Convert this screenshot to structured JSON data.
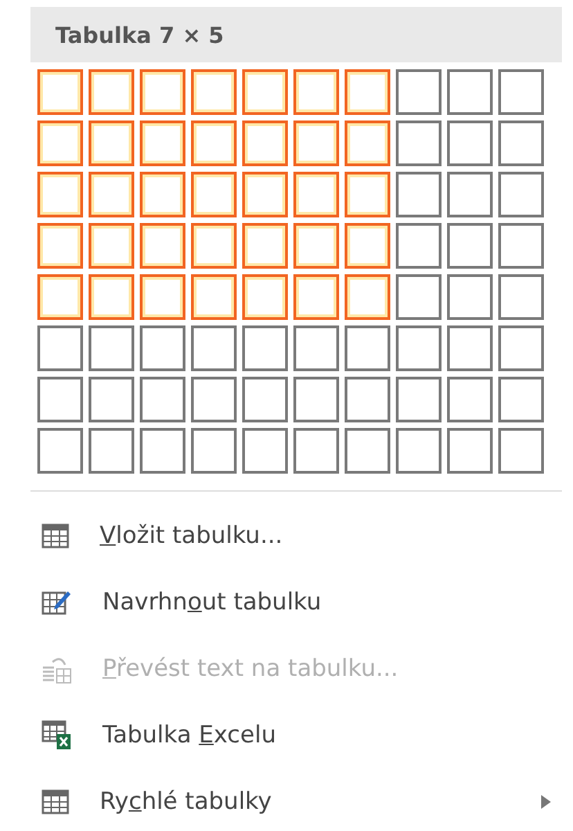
{
  "header": {
    "title": "Tabulka 7 × 5"
  },
  "grid": {
    "rows": [
      [
        {
          "selected": true
        },
        {
          "selected": true
        },
        {
          "selected": true
        },
        {
          "selected": true
        },
        {
          "selected": true
        },
        {
          "selected": true
        },
        {
          "selected": true
        },
        {
          "selected": false
        },
        {
          "selected": false
        },
        {
          "selected": false
        }
      ],
      [
        {
          "selected": true
        },
        {
          "selected": true
        },
        {
          "selected": true
        },
        {
          "selected": true
        },
        {
          "selected": true
        },
        {
          "selected": true
        },
        {
          "selected": true
        },
        {
          "selected": false
        },
        {
          "selected": false
        },
        {
          "selected": false
        }
      ],
      [
        {
          "selected": true
        },
        {
          "selected": true
        },
        {
          "selected": true
        },
        {
          "selected": true
        },
        {
          "selected": true
        },
        {
          "selected": true
        },
        {
          "selected": true
        },
        {
          "selected": false
        },
        {
          "selected": false
        },
        {
          "selected": false
        }
      ],
      [
        {
          "selected": true
        },
        {
          "selected": true
        },
        {
          "selected": true
        },
        {
          "selected": true
        },
        {
          "selected": true
        },
        {
          "selected": true
        },
        {
          "selected": true
        },
        {
          "selected": false
        },
        {
          "selected": false
        },
        {
          "selected": false
        }
      ],
      [
        {
          "selected": true
        },
        {
          "selected": true
        },
        {
          "selected": true
        },
        {
          "selected": true
        },
        {
          "selected": true
        },
        {
          "selected": true
        },
        {
          "selected": true
        },
        {
          "selected": false
        },
        {
          "selected": false
        },
        {
          "selected": false
        }
      ],
      [
        {
          "selected": false
        },
        {
          "selected": false
        },
        {
          "selected": false
        },
        {
          "selected": false
        },
        {
          "selected": false
        },
        {
          "selected": false
        },
        {
          "selected": false
        },
        {
          "selected": false
        },
        {
          "selected": false
        },
        {
          "selected": false
        }
      ],
      [
        {
          "selected": false
        },
        {
          "selected": false
        },
        {
          "selected": false
        },
        {
          "selected": false
        },
        {
          "selected": false
        },
        {
          "selected": false
        },
        {
          "selected": false
        },
        {
          "selected": false
        },
        {
          "selected": false
        },
        {
          "selected": false
        }
      ],
      [
        {
          "selected": false
        },
        {
          "selected": false
        },
        {
          "selected": false
        },
        {
          "selected": false
        },
        {
          "selected": false
        },
        {
          "selected": false
        },
        {
          "selected": false
        },
        {
          "selected": false
        },
        {
          "selected": false
        },
        {
          "selected": false
        }
      ]
    ]
  },
  "menu": [
    {
      "kind": "insert",
      "access_key": "V",
      "label_after": "ložit tabulku...",
      "disabled": false,
      "submenu": false
    },
    {
      "kind": "draw",
      "label_before": "Navrhn",
      "access_key": "o",
      "label_after": "ut tabulku",
      "disabled": false,
      "submenu": false
    },
    {
      "kind": "convert",
      "access_key": "P",
      "label_after": "řevést text na tabulku...",
      "disabled": true,
      "submenu": false
    },
    {
      "kind": "excel",
      "label_before": "Tabulka ",
      "access_key": "E",
      "label_after": "xcelu",
      "disabled": false,
      "submenu": false
    },
    {
      "kind": "quick",
      "label_before": "Ry",
      "access_key": "c",
      "label_after": "hlé tabulky",
      "disabled": false,
      "submenu": true
    }
  ]
}
